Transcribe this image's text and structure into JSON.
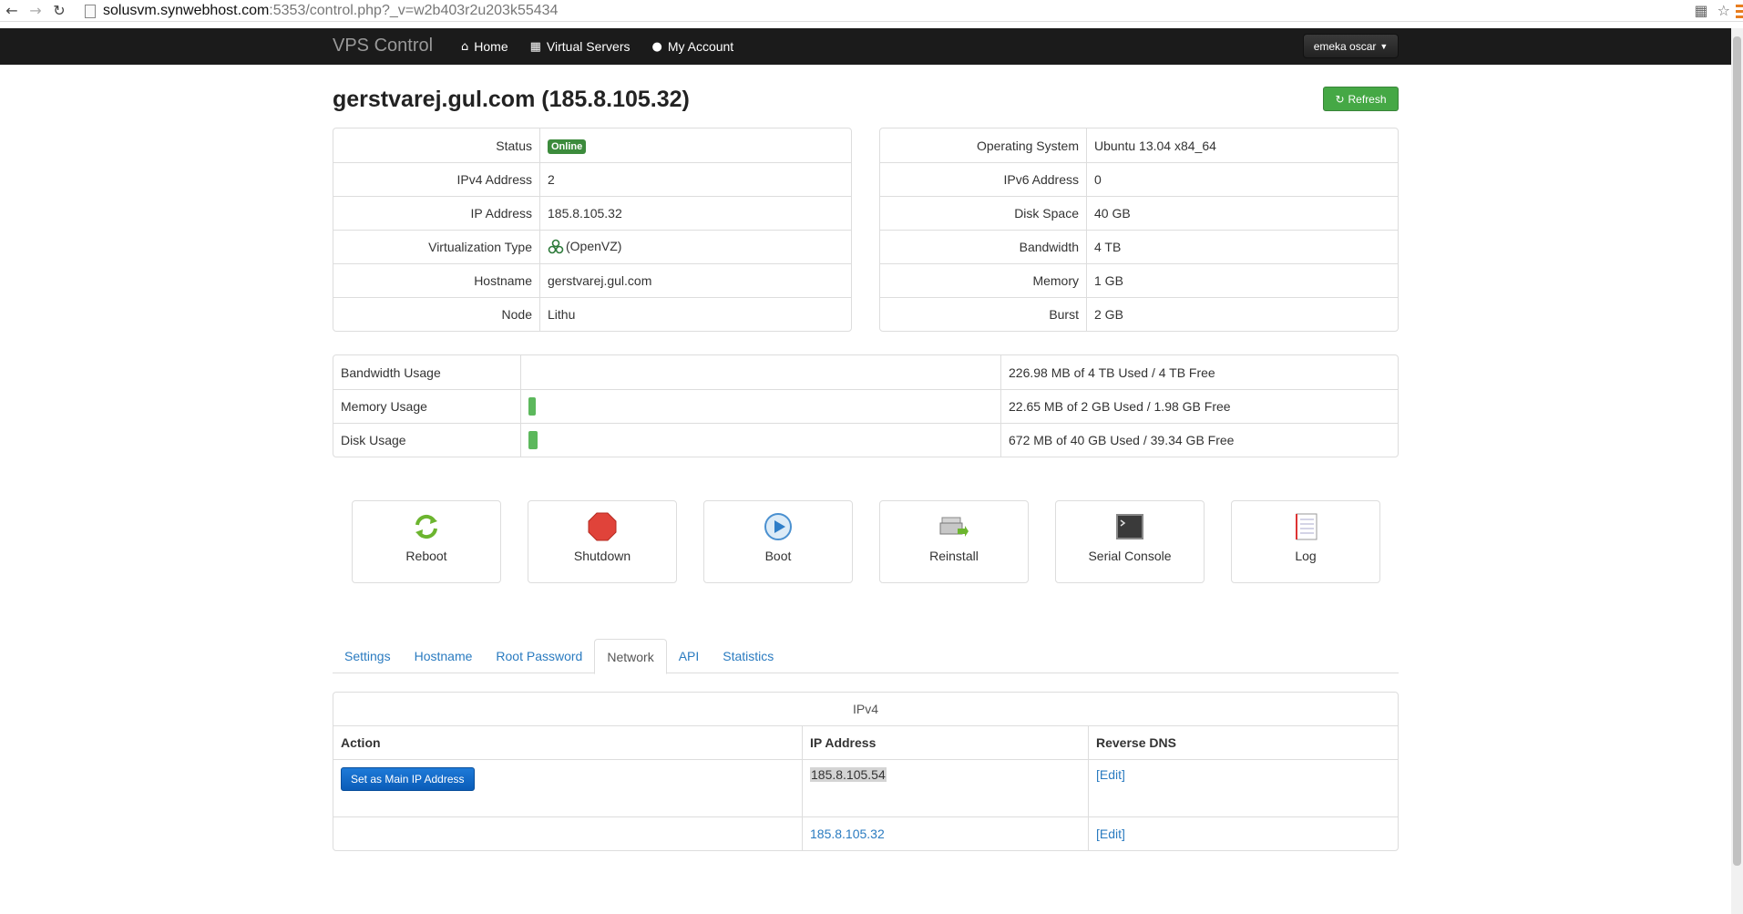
{
  "browser": {
    "url_host": "solusvm.synwebhost.com",
    "url_rest": ":5353/control.php?_v=w2b403r2u203k55434",
    "back_icon": "arrow-left-icon",
    "forward_icon": "arrow-right-icon",
    "reload_icon": "reload-icon"
  },
  "navbar": {
    "brand": "VPS Control",
    "links": [
      {
        "label": "Home",
        "icon": "home-icon"
      },
      {
        "label": "Virtual Servers",
        "icon": "grid-icon"
      },
      {
        "label": "My Account",
        "icon": "user-icon"
      }
    ],
    "user": "emeka oscar"
  },
  "page": {
    "title": "gerstvarej.gul.com (185.8.105.32)",
    "refresh_label": "Refresh"
  },
  "info_left": [
    {
      "key": "Status",
      "value": "Online"
    },
    {
      "key": "IPv4 Address",
      "value": "2"
    },
    {
      "key": "IP Address",
      "value": "185.8.105.32"
    },
    {
      "key": "Virtualization Type",
      "value": "(OpenVZ)"
    },
    {
      "key": "Hostname",
      "value": "gerstvarej.gul.com"
    },
    {
      "key": "Node",
      "value": "Lithu"
    }
  ],
  "info_right": [
    {
      "key": "Operating System",
      "value": "Ubuntu 13.04 x84_64"
    },
    {
      "key": "IPv6 Address",
      "value": "0"
    },
    {
      "key": "Disk Space",
      "value": "40 GB"
    },
    {
      "key": "Bandwidth",
      "value": "4 TB"
    },
    {
      "key": "Memory",
      "value": "1 GB"
    },
    {
      "key": "Burst",
      "value": "2 GB"
    }
  ],
  "usage": [
    {
      "label": "Bandwidth Usage",
      "percent": 0,
      "text": "226.98 MB of 4 TB Used / 4 TB Free"
    },
    {
      "label": "Memory Usage",
      "percent": 1,
      "text": "22.65 MB of 2 GB Used / 1.98 GB Free"
    },
    {
      "label": "Disk Usage",
      "percent": 2,
      "text": "672 MB of 40 GB Used / 39.34 GB Free"
    }
  ],
  "actions": [
    {
      "label": "Reboot",
      "icon": "reboot-icon"
    },
    {
      "label": "Shutdown",
      "icon": "shutdown-icon"
    },
    {
      "label": "Boot",
      "icon": "boot-icon"
    },
    {
      "label": "Reinstall",
      "icon": "reinstall-icon"
    },
    {
      "label": "Serial Console",
      "icon": "console-icon"
    },
    {
      "label": "Log",
      "icon": "log-icon"
    }
  ],
  "tabs": [
    "Settings",
    "Hostname",
    "Root Password",
    "Network",
    "API",
    "Statistics"
  ],
  "active_tab": "Network",
  "ipv4": {
    "caption": "IPv4",
    "headers": [
      "Action",
      "IP Address",
      "Reverse DNS"
    ],
    "rows": [
      {
        "action": "Set as Main IP Address",
        "ip": "185.8.105.54",
        "rdns": "[Edit]"
      },
      {
        "action": "",
        "ip": "185.8.105.32",
        "rdns": "[Edit]"
      }
    ]
  },
  "colors": {
    "navbar": "#1b1b1b",
    "online_badge": "#3c8b3c",
    "refresh_button": "#45a845",
    "primary_button": "#0a5cb8",
    "link": "#2a7bc0"
  }
}
